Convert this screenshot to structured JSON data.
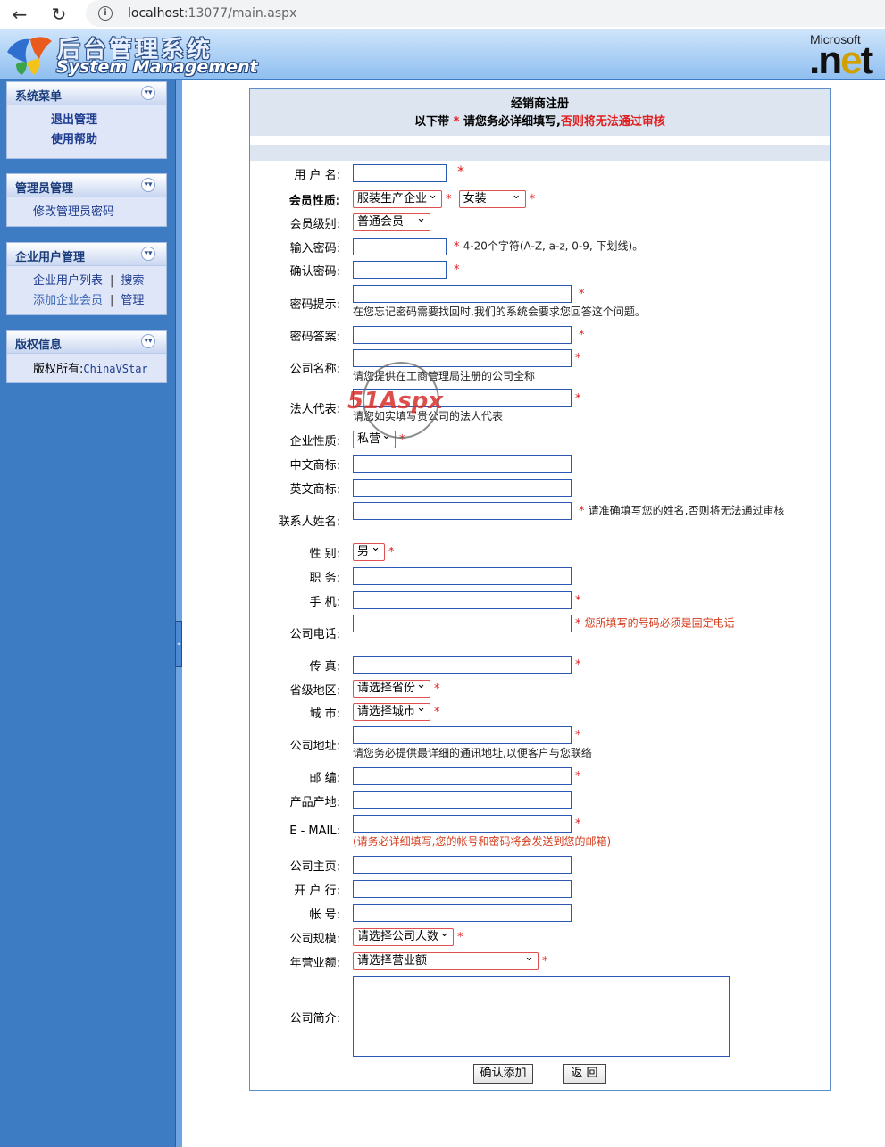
{
  "browser": {
    "url_host": "localhost",
    "url_rest": ":13077/main.aspx"
  },
  "header": {
    "logo_cn": "后台管理系统",
    "logo_en": "System Management",
    "ms_text": "Microsoft",
    "net_text": ".net"
  },
  "sidebar": {
    "system_menu": {
      "title": "系统菜单",
      "items": [
        "退出管理",
        "使用帮助"
      ]
    },
    "admin_mgmt": {
      "title": "管理员管理",
      "items": [
        "修改管理员密码"
      ]
    },
    "enterprise_mgmt": {
      "title": "企业用户管理",
      "items": [
        "企业用户列表",
        "搜索",
        "添加企业会员",
        "管理"
      ],
      "sep": "|"
    },
    "copyright": {
      "title": "版权信息",
      "owner_label": "版权所有:",
      "owner": "ChinaVStar"
    }
  },
  "form": {
    "title": "经销商注册",
    "subtitle_pre": "以下带",
    "subtitle_star": "*",
    "subtitle_mid": "请您务必详细填写,",
    "subtitle_red": "否则将无法通过审核",
    "star": "*",
    "fields": {
      "username": "用 户 名:",
      "member_type": "会员性质:",
      "member_level": "会员级别:",
      "password": "输入密码:",
      "password_hint": "4-20个字符(A-Z, a-z, 0-9, 下划线)。",
      "confirm_password": "确认密码:",
      "pwd_question": "密码提示:",
      "pwd_question_note": "在您忘记密码需要找回时,我们的系统会要求您回答这个问题。",
      "pwd_answer": "密码答案:",
      "company_name": "公司名称:",
      "company_name_note": "请您提供在工商管理局注册的公司全称",
      "legal_rep": "法人代表:",
      "legal_rep_note": "请您如实填写贵公司的法人代表",
      "ent_type": "企业性质:",
      "cn_brand": "中文商标:",
      "en_brand": "英文商标:",
      "contact": "联系人姓名:",
      "contact_hint": "请准确填写您的姓名,否则将无法通过审核",
      "gender": "性 别:",
      "position": "职 务:",
      "mobile": "手 机:",
      "phone": "公司电话:",
      "phone_hint": "您所填写的号码必须是固定电话",
      "fax": "传 真:",
      "province": "省级地区:",
      "city": "城 市:",
      "address": "公司地址:",
      "address_note": "请您务必提供最详细的通讯地址,以便客户与您联络",
      "zip": "邮 编:",
      "origin": "产品产地:",
      "email": "E - MAIL:",
      "email_note": "(请务必详细填写,您的帐号和密码将会发送到您的邮箱)",
      "homepage": "公司主页:",
      "bank": "开 户 行:",
      "account": "帐 号:",
      "scale": "公司规模:",
      "revenue": "年营业额:",
      "intro": "公司简介:"
    },
    "selects": {
      "member_type": "服装生产企业",
      "member_subtype": "女装",
      "member_level": "普通会员",
      "ent_type": "私营",
      "gender": "男",
      "province": "请选择省份",
      "city": "请选择城市",
      "scale": "请选择公司人数",
      "revenue": "请选择营业额"
    },
    "buttons": {
      "submit": "确认添加",
      "back": "返 回"
    }
  },
  "watermark": {
    "text": "51Aspx"
  }
}
